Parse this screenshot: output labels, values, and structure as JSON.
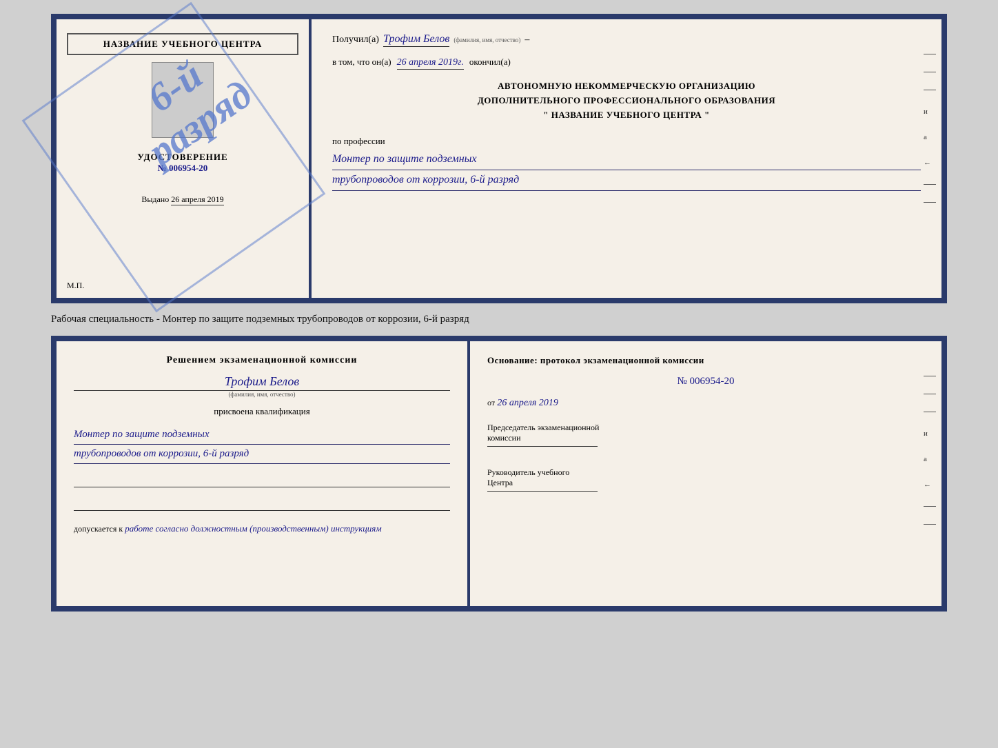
{
  "top_cert": {
    "left": {
      "title": "НАЗВАНИЕ УЧЕБНОГО ЦЕНТРА",
      "stamp_text": "6-й разряд",
      "udost_label": "УДОСТОВЕРЕНИЕ",
      "udost_num": "№ 006954-20",
      "issued_prefix": "Выдано",
      "issued_date": "26 апреля 2019",
      "mp_label": "М.П."
    },
    "right": {
      "received_prefix": "Получил(а)",
      "received_name": "Трофим Белов",
      "received_sublabel": "(фамилия, имя, отчество)",
      "in_that_prefix": "в том, что он(а)",
      "in_that_date": "26 апреля 2019г.",
      "finished_label": "окончил(а)",
      "org_line1": "АВТОНОМНУЮ НЕКОММЕРЧЕСКУЮ ОРГАНИЗАЦИЮ",
      "org_line2": "ДОПОЛНИТЕЛЬНОГО ПРОФЕССИОНАЛЬНОГО ОБРАЗОВАНИЯ",
      "org_line3": "\"   НАЗВАНИЕ УЧЕБНОГО ЦЕНТРА   \"",
      "profession_prefix": "по профессии",
      "profession_line1": "Монтер по защите подземных",
      "profession_line2": "трубопроводов от коррозии, 6-й разряд"
    }
  },
  "specialty_label": "Рабочая специальность - Монтер по защите подземных трубопроводов от коррозии, 6-й разряд",
  "bottom_cert": {
    "left": {
      "decision_title": "Решением экзаменационной комиссии",
      "name": "Трофим Белов",
      "name_sublabel": "(фамилия, имя, отчество)",
      "qualification_label": "присвоена квалификация",
      "qualification_line1": "Монтер по защите подземных",
      "qualification_line2": "трубопроводов от коррозии, 6-й разряд",
      "allowed_prefix": "допускается к",
      "allowed_text": "работе согласно должностным (производственным) инструкциям"
    },
    "right": {
      "basis_label": "Основание: протокол экзаменационной комиссии",
      "basis_num": "№ 006954-20",
      "basis_date_prefix": "от",
      "basis_date": "26 апреля 2019",
      "chairman_line1": "Председатель экзаменационной",
      "chairman_line2": "комиссии",
      "director_line1": "Руководитель учебного",
      "director_line2": "Центра"
    }
  }
}
